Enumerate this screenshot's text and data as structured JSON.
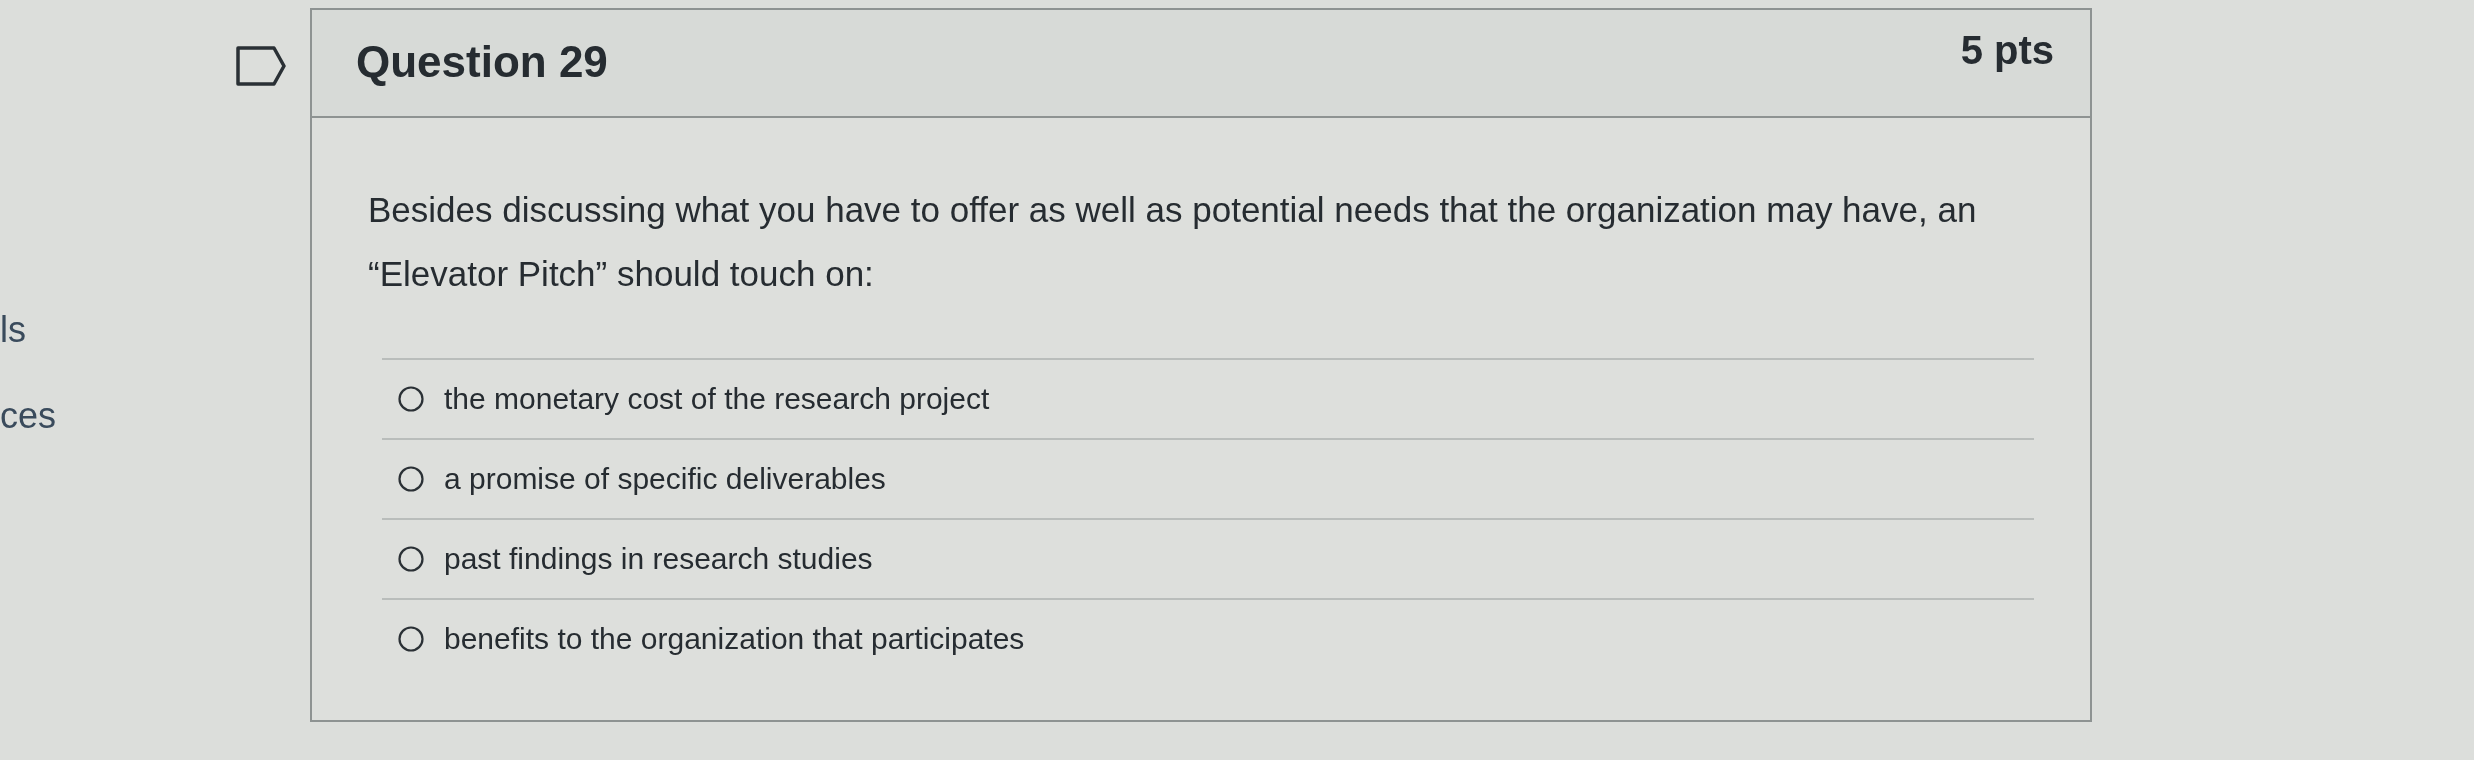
{
  "sidebar": {
    "items": [
      {
        "label": "ls"
      },
      {
        "label": "ces"
      }
    ]
  },
  "question": {
    "title": "Question 29",
    "points": "5 pts",
    "text": "Besides discussing what you have to offer as well as potential needs that the organization may have, an “Elevator Pitch” should touch on:",
    "answers": [
      {
        "label": "the monetary cost of the research project",
        "selected": false
      },
      {
        "label": "a promise of specific deliverables",
        "selected": false
      },
      {
        "label": "past findings in research studies",
        "selected": false
      },
      {
        "label": "benefits to the organization that participates",
        "selected": false
      }
    ]
  }
}
